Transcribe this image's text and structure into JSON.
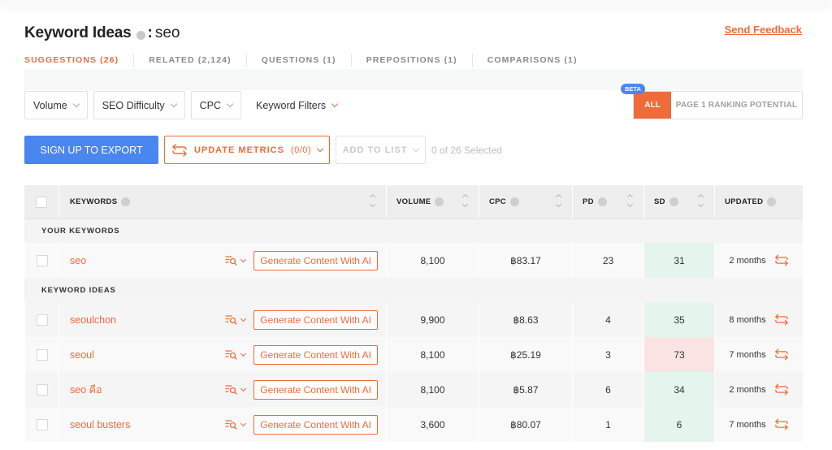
{
  "header": {
    "title": "Keyword Ideas",
    "colon": ":",
    "query": "seo",
    "send_feedback": "Send Feedback"
  },
  "tabs": [
    {
      "label": "SUGGESTIONS (26)",
      "active": true
    },
    {
      "label": "RELATED (2,124)",
      "active": false
    },
    {
      "label": "QUESTIONS (1)",
      "active": false
    },
    {
      "label": "PREPOSITIONS (1)",
      "active": false
    },
    {
      "label": "COMPARISONS (1)",
      "active": false
    }
  ],
  "filters": {
    "volume": "Volume",
    "seo_difficulty": "SEO Difficulty",
    "cpc": "CPC",
    "keyword_filters": "Keyword Filters"
  },
  "ranking_toggle": {
    "beta_badge": "BETA",
    "all": "ALL",
    "page1": "PAGE 1 RANKING POTENTIAL",
    "selected": "ALL"
  },
  "actions": {
    "export": "SIGN UP TO EXPORT",
    "update_metrics": "UPDATE METRICS",
    "update_count": "(0/0)",
    "add_to_list": "ADD TO LIST",
    "selected_count": "0 of 26 Selected"
  },
  "table": {
    "columns": {
      "keywords": "KEYWORDS",
      "volume": "VOLUME",
      "cpc": "CPC",
      "pd": "PD",
      "sd": "SD",
      "updated": "UPDATED"
    },
    "groups": {
      "your_keywords": "YOUR KEYWORDS",
      "keyword_ideas": "KEYWORD IDEAS"
    },
    "generate_label": "Generate Content With AI",
    "your_keywords": [
      {
        "keyword": "seo",
        "volume": "8,100",
        "cpc": "฿83.17",
        "pd": "23",
        "sd": "31",
        "sd_level": "green",
        "updated": "2 months"
      }
    ],
    "keyword_ideas": [
      {
        "keyword": "seoulchon",
        "volume": "9,900",
        "cpc": "฿8.63",
        "pd": "4",
        "sd": "35",
        "sd_level": "green",
        "updated": "8 months"
      },
      {
        "keyword": "seoul",
        "volume": "8,100",
        "cpc": "฿25.19",
        "pd": "3",
        "sd": "73",
        "sd_level": "red",
        "updated": "7 months"
      },
      {
        "keyword": "seo คือ",
        "volume": "8,100",
        "cpc": "฿5.87",
        "pd": "6",
        "sd": "34",
        "sd_level": "green",
        "updated": "2 months"
      },
      {
        "keyword": "seoul busters",
        "volume": "3,600",
        "cpc": "฿80.07",
        "pd": "1",
        "sd": "6",
        "sd_level": "green",
        "updated": "7 months"
      }
    ]
  },
  "colors": {
    "accent": "#f06b3a",
    "primary_blue": "#4a86f0",
    "sd_green": "#e3f5ec",
    "sd_red": "#fce3e3"
  }
}
